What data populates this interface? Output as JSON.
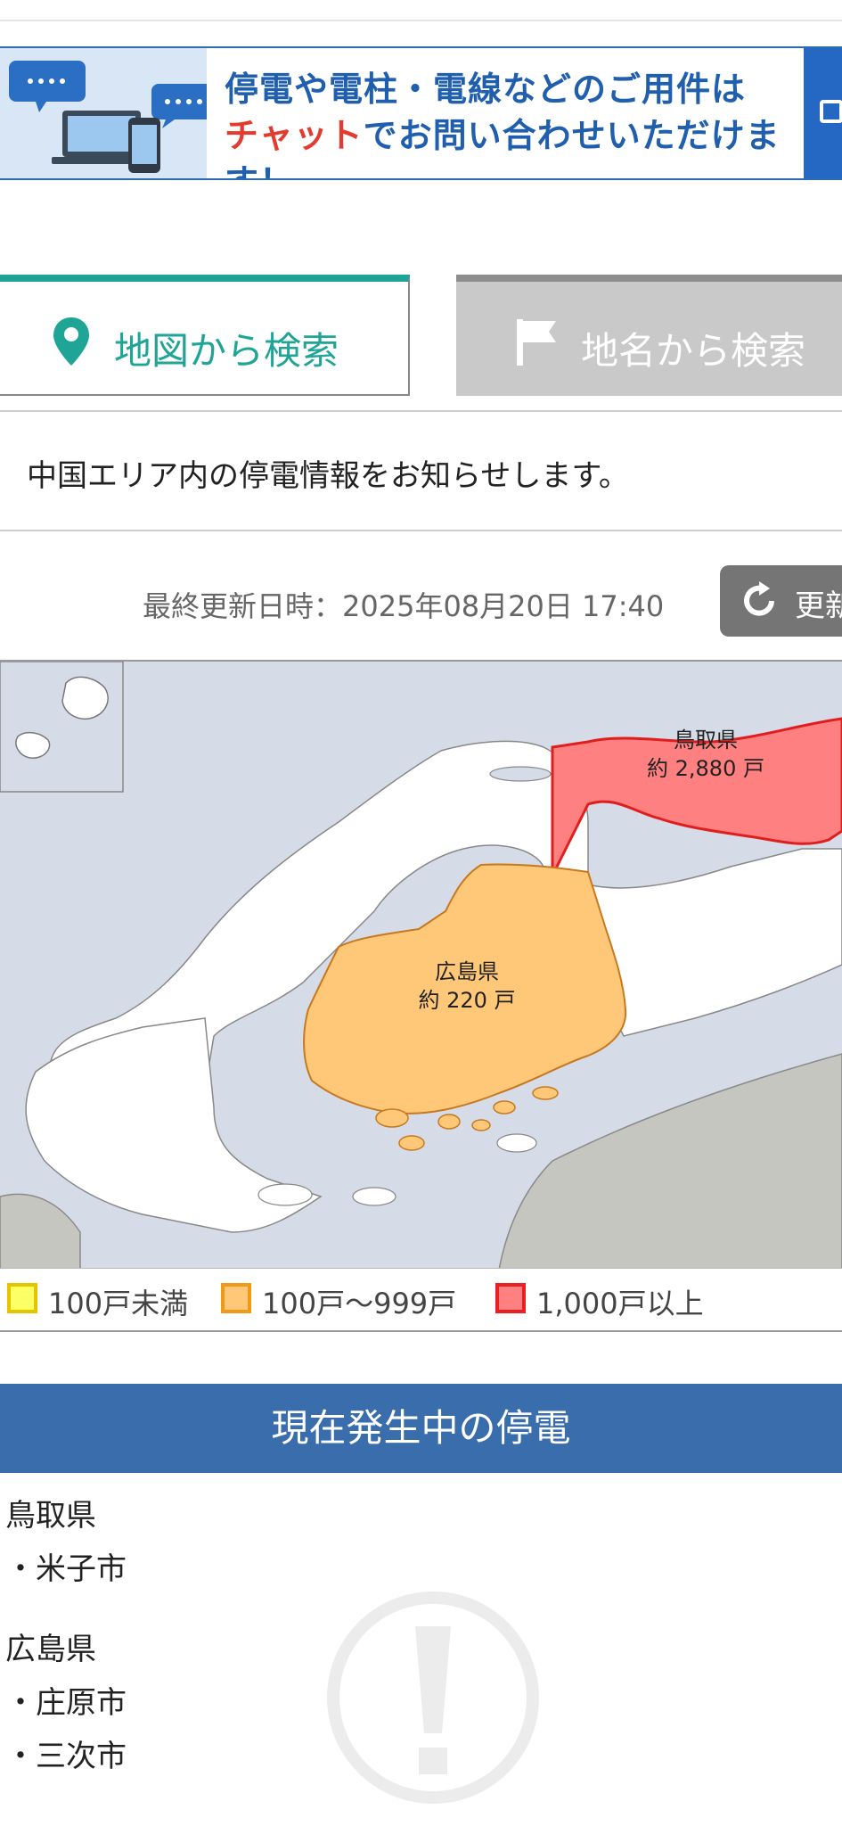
{
  "banner": {
    "line1": "停電や電柱・電線などのご用件は",
    "line2_red": "チャット",
    "line2_rest": "でお問い合わせいただけます！",
    "icon": "chat-devices-icon"
  },
  "tabs": [
    {
      "label": "地図から検索",
      "icon": "map-pin-icon",
      "active": true
    },
    {
      "label": "地名から検索",
      "icon": "flag-icon",
      "active": false
    }
  ],
  "notice": "中国エリア内の停電情報をお知らせします。",
  "last_updated": "最終更新日時：2025年08月20日 17:40",
  "refresh_label": "更新",
  "map": {
    "regions": [
      {
        "name": "鳥取県",
        "count": "約 2,880 戸",
        "level": "1000plus"
      },
      {
        "name": "広島県",
        "count": "約 220 戸",
        "level": "100to999"
      }
    ]
  },
  "legend": [
    {
      "label": "100戸未満",
      "fill": "#ffff66",
      "border": "#e7c400"
    },
    {
      "label": "100戸〜999戸",
      "fill": "#ffc878",
      "border": "#f09a1a"
    },
    {
      "label": "1,000戸以上",
      "fill": "#ff8080",
      "border": "#e82020"
    }
  ],
  "colors": {
    "accent": "#1fa596",
    "section": "#3a6dac",
    "orange_region": "#ffc878",
    "red_region": "#ff8080"
  },
  "current_outages": {
    "title": "現在発生中の停電",
    "groups": [
      {
        "pref": "鳥取県",
        "cities": [
          "・米子市"
        ]
      },
      {
        "pref": "広島県",
        "cities": [
          "・庄原市",
          "・三次市"
        ]
      }
    ]
  }
}
